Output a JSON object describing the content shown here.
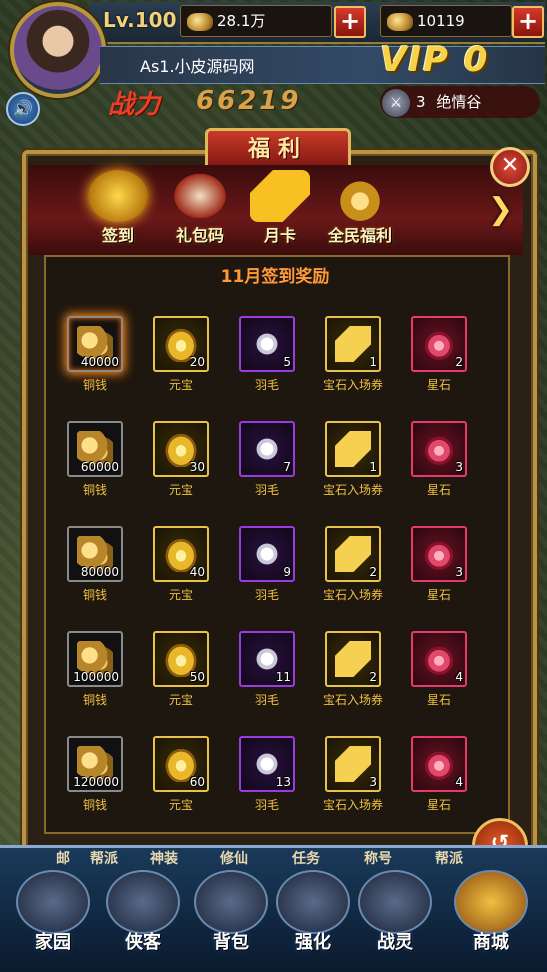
{
  "hud": {
    "level": "Lv.100",
    "copper": "28.1万",
    "ingot": "10119",
    "player_name": "As1.小皮源码网",
    "vip": "VIP 0",
    "power_label": "战力",
    "power_value": "66219",
    "guild_rank": "3",
    "guild_name": "绝情谷",
    "plus": "+"
  },
  "panel": {
    "title": "福利",
    "close": "✕",
    "next_arrow": "❯",
    "heading": "11月签到奖励",
    "tabs": [
      {
        "label": "签到",
        "active": true
      },
      {
        "label": "礼包码",
        "active": false
      },
      {
        "label": "月卡",
        "active": false
      },
      {
        "label": "全民福利",
        "active": false
      }
    ]
  },
  "rewards": [
    [
      {
        "name": "铜钱",
        "count": "40000",
        "quality": "gray",
        "icon": "coin",
        "glow": true
      },
      {
        "name": "元宝",
        "count": "20",
        "quality": "gold",
        "icon": "ingot"
      },
      {
        "name": "羽毛",
        "count": "5",
        "quality": "purple",
        "icon": "feather"
      },
      {
        "name": "宝石入场券",
        "count": "1",
        "quality": "gold",
        "icon": "scroll"
      },
      {
        "name": "星石",
        "count": "2",
        "quality": "red",
        "icon": "star"
      }
    ],
    [
      {
        "name": "铜钱",
        "count": "60000",
        "quality": "gray",
        "icon": "coin"
      },
      {
        "name": "元宝",
        "count": "30",
        "quality": "gold",
        "icon": "ingot"
      },
      {
        "name": "羽毛",
        "count": "7",
        "quality": "purple",
        "icon": "feather"
      },
      {
        "name": "宝石入场券",
        "count": "1",
        "quality": "gold",
        "icon": "scroll"
      },
      {
        "name": "星石",
        "count": "3",
        "quality": "red",
        "icon": "star"
      }
    ],
    [
      {
        "name": "铜钱",
        "count": "80000",
        "quality": "gray",
        "icon": "coin"
      },
      {
        "name": "元宝",
        "count": "40",
        "quality": "gold",
        "icon": "ingot"
      },
      {
        "name": "羽毛",
        "count": "9",
        "quality": "purple",
        "icon": "feather"
      },
      {
        "name": "宝石入场券",
        "count": "2",
        "quality": "gold",
        "icon": "scroll"
      },
      {
        "name": "星石",
        "count": "3",
        "quality": "red",
        "icon": "star"
      }
    ],
    [
      {
        "name": "铜钱",
        "count": "100000",
        "quality": "gray",
        "icon": "coin"
      },
      {
        "name": "元宝",
        "count": "50",
        "quality": "gold",
        "icon": "ingot"
      },
      {
        "name": "羽毛",
        "count": "11",
        "quality": "purple",
        "icon": "feather"
      },
      {
        "name": "宝石入场券",
        "count": "2",
        "quality": "gold",
        "icon": "scroll"
      },
      {
        "name": "星石",
        "count": "4",
        "quality": "red",
        "icon": "star"
      }
    ],
    [
      {
        "name": "铜钱",
        "count": "120000",
        "quality": "gray",
        "icon": "coin"
      },
      {
        "name": "元宝",
        "count": "60",
        "quality": "gold",
        "icon": "ingot"
      },
      {
        "name": "羽毛",
        "count": "13",
        "quality": "purple",
        "icon": "feather"
      },
      {
        "name": "宝石入场券",
        "count": "3",
        "quality": "gold",
        "icon": "scroll"
      },
      {
        "name": "星石",
        "count": "4",
        "quality": "red",
        "icon": "star"
      }
    ]
  ],
  "bottom": {
    "strip": [
      "邮",
      "帮派",
      "神装",
      "修仙",
      "任务",
      "称号",
      "帮派"
    ],
    "nav": [
      "家园",
      "侠客",
      "背包",
      "强化",
      "战灵",
      "商城"
    ],
    "return_label": "返回"
  }
}
